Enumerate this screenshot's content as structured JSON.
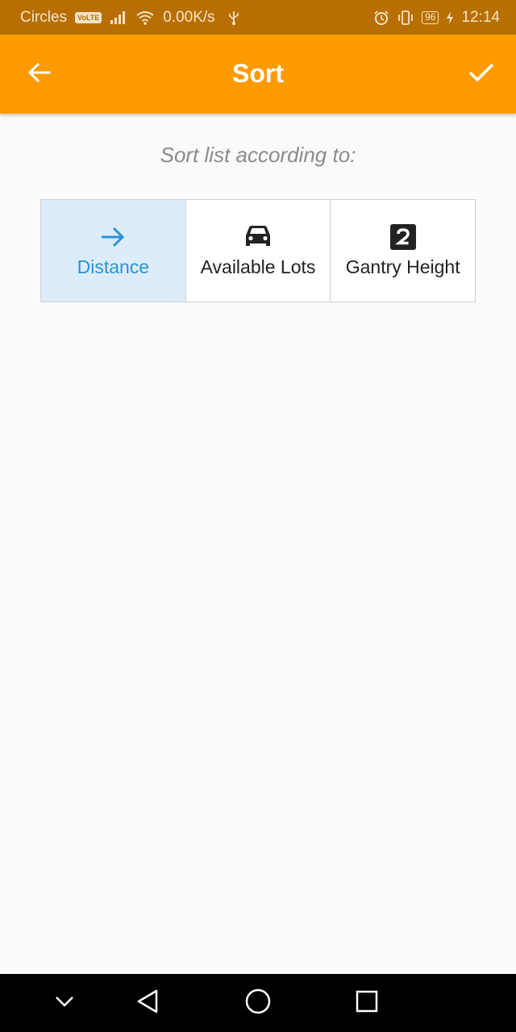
{
  "status_bar": {
    "carrier": "Circles",
    "volte": "VoLTE",
    "net_speed": "0.00K/s",
    "battery": "96",
    "time": "12:14"
  },
  "app_bar": {
    "title": "Sort",
    "back_icon": "arrow-back-icon",
    "confirm_icon": "check-icon",
    "color": "#ff9a00"
  },
  "content": {
    "subtitle": "Sort list according to:",
    "options": [
      {
        "label": "Distance",
        "icon": "arrow-right-icon",
        "selected": true
      },
      {
        "label": "Available Lots",
        "icon": "car-icon",
        "selected": false
      },
      {
        "label": "Gantry Height",
        "icon": "number-2-icon",
        "selected": false
      }
    ],
    "selected_color": "#2b93d6",
    "selected_bg": "#dcecf9"
  },
  "nav_bar": {
    "buttons": [
      "chevron-down-icon",
      "back-triangle-icon",
      "home-circle-icon",
      "recents-square-icon"
    ]
  }
}
